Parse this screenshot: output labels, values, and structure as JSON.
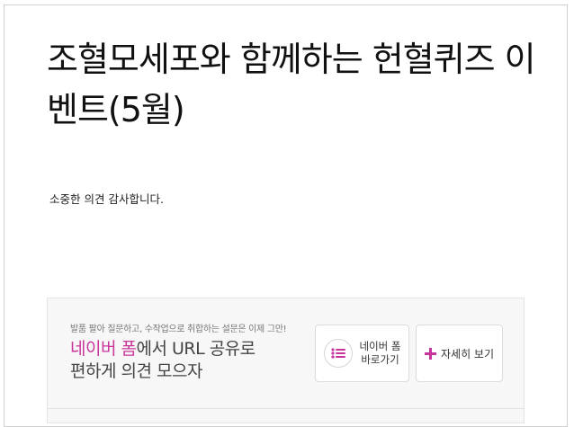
{
  "post": {
    "title": "조혈모세포와 함께하는 헌혈퀴즈 이벤트(5월)",
    "message": "소중한 의견 감사합니다."
  },
  "promo": {
    "tagline": "발품 팔아 질문하고, 수작업으로 취합하는 설문은 이제 그만!",
    "headline_brand": "네이버 폼",
    "headline_rest_line1": "에서 URL 공유로",
    "headline_line2": "편하게 의견 모으자",
    "form_button": {
      "line1": "네이버 폼",
      "line2": "바로가기"
    },
    "detail_button": {
      "label": "자세히 보기"
    }
  },
  "colors": {
    "brand": "#c8359a",
    "title": "#111111",
    "panel_bg": "#f7f7f7"
  }
}
